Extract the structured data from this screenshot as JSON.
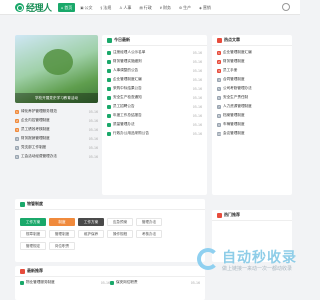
{
  "header": {
    "logo_text": "经理人",
    "nav": [
      {
        "icon": "⌂",
        "label": "首页"
      },
      {
        "icon": "▣",
        "label": "公文"
      },
      {
        "icon": "§",
        "label": "法规"
      },
      {
        "icon": "♙",
        "label": "人事"
      },
      {
        "icon": "▤",
        "label": "行政"
      },
      {
        "icon": "¥",
        "label": "财务"
      },
      {
        "icon": "⚙",
        "label": "生产"
      },
      {
        "icon": "◈",
        "label": "营销"
      }
    ]
  },
  "hero": {
    "caption": "学校开展党史学习教育活动"
  },
  "left_list": [
    {
      "num": "1",
      "text": "绿化养护管理服务规范",
      "date": "05-16"
    },
    {
      "num": "2",
      "text": "企业内控管理制度",
      "date": "05-16"
    },
    {
      "num": "3",
      "text": "员工绩效考核制度",
      "date": "05-16"
    },
    {
      "num": "4",
      "text": "财务报销管理制度",
      "date": "05-16"
    },
    {
      "num": "5",
      "text": "党支部工作制度",
      "date": "05-16"
    },
    {
      "num": "6",
      "text": "工会活动经费管理办法",
      "date": "05-16"
    }
  ],
  "hot_news": {
    "title": "今日最新",
    "items": [
      {
        "text": "注册经理人公示名单",
        "date": "05-16"
      },
      {
        "text": "财务管理实施细则",
        "date": "05-16"
      },
      {
        "text": "人事调整的公告",
        "date": "05-16"
      },
      {
        "text": "企业管理制度汇编",
        "date": "05-16"
      },
      {
        "text": "采购中标结果公告",
        "date": "05-16"
      },
      {
        "text": "安全生产检查通知",
        "date": "05-16"
      },
      {
        "text": "员工招聘公告",
        "date": "05-16"
      },
      {
        "text": "年度工作总结报告",
        "date": "05-16"
      },
      {
        "text": "质量管理办法",
        "date": "05-16"
      },
      {
        "text": "行政办公用品采购公告",
        "date": "05-16"
      }
    ]
  },
  "hot_articles": {
    "title": "热点文章",
    "items": [
      {
        "num": "1",
        "text": "企业管理制度汇编"
      },
      {
        "num": "2",
        "text": "财务管理制度"
      },
      {
        "num": "3",
        "text": "员工手册"
      },
      {
        "num": "4",
        "text": "合同管理制度"
      },
      {
        "num": "5",
        "text": "公司考勤管理办法"
      },
      {
        "num": "6",
        "text": "安全生产责任制"
      },
      {
        "num": "7",
        "text": "人力资源管理制度"
      },
      {
        "num": "8",
        "text": "档案管理制度"
      },
      {
        "num": "9",
        "text": "车辆管理制度"
      },
      {
        "num": "10",
        "text": "会议管理制度"
      }
    ]
  },
  "system_section": {
    "title": "物管制度",
    "tabs": [
      {
        "label": "工作方案",
        "style": "green"
      },
      {
        "label": "制度",
        "style": "orange"
      },
      {
        "label": "工作方案",
        "style": "dark"
      },
      {
        "label": "应急预案",
        "style": ""
      },
      {
        "label": "管理办法",
        "style": ""
      },
      {
        "label": "规章制度",
        "style": ""
      },
      {
        "label": "管理制度",
        "style": ""
      },
      {
        "label": "维护保养",
        "style": ""
      },
      {
        "label": "操作规程",
        "style": ""
      },
      {
        "label": "考核办法",
        "style": ""
      },
      {
        "label": "管理规定",
        "style": ""
      },
      {
        "label": "岗位职责",
        "style": ""
      }
    ]
  },
  "side_section": {
    "title": "热门推荐"
  },
  "recommend": {
    "title": "最新推荐",
    "items": [
      {
        "text": "物业管理服务制度",
        "date": "05-16"
      },
      {
        "text": "保安岗位职责",
        "date": "05-16"
      }
    ]
  },
  "watermark": {
    "title": "自动秒收录",
    "sub": "做上链接一来动一次一都动收录"
  },
  "colors": {
    "accent": "#1aa86a",
    "orange": "#f08a3c",
    "red": "#e74c3c"
  }
}
